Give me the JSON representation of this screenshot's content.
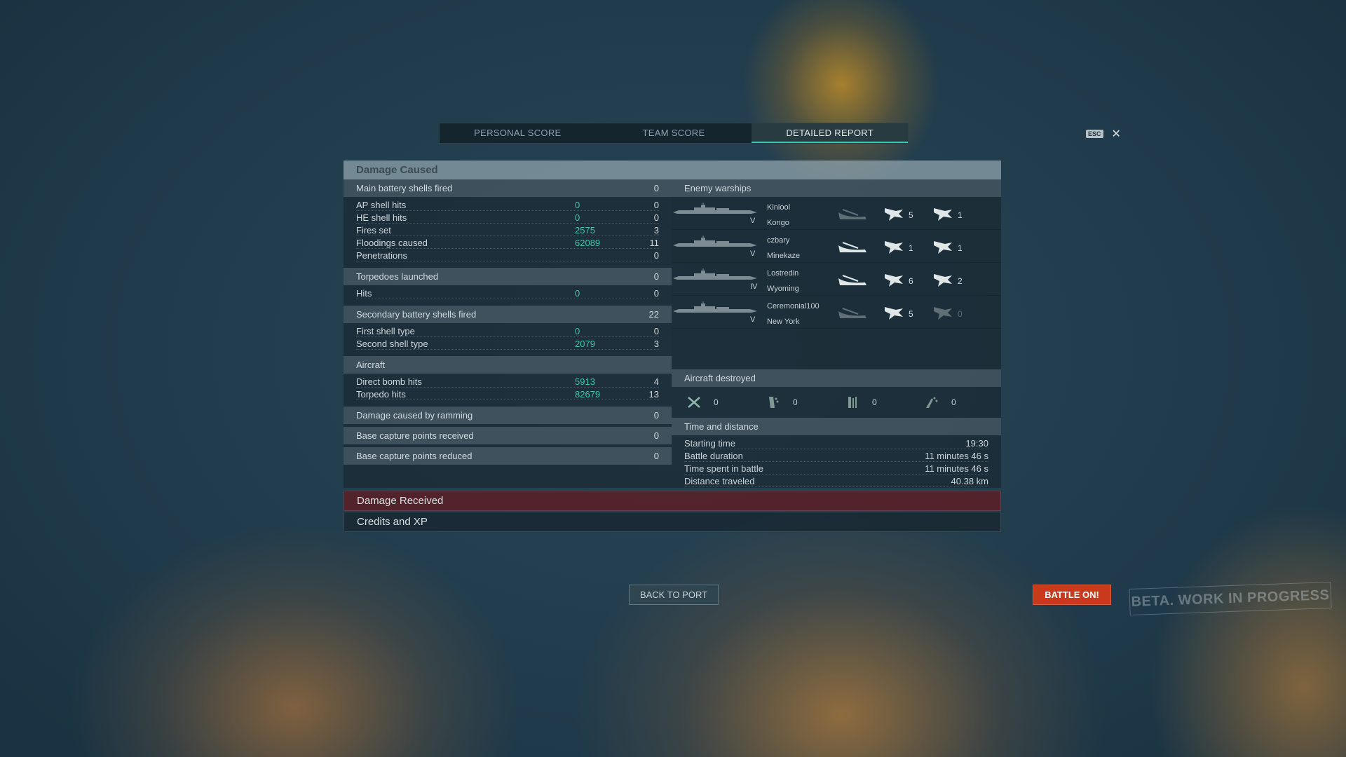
{
  "tabs": [
    "PERSONAL SCORE",
    "TEAM SCORE",
    "DETAILED REPORT"
  ],
  "esc_label": "ESC",
  "close_glyph": "✕",
  "damage_caused": {
    "title": "Damage Caused",
    "main_battery": {
      "label": "Main battery shells fired",
      "value": "0",
      "rows": [
        {
          "label": "AP shell hits",
          "damage": "0",
          "count": "0"
        },
        {
          "label": "HE shell hits",
          "damage": "0",
          "count": "0"
        },
        {
          "label": "Fires set",
          "damage": "2575",
          "count": "3"
        },
        {
          "label": "Floodings caused",
          "damage": "62089",
          "count": "11"
        },
        {
          "label": "Penetrations",
          "damage": "",
          "count": "0"
        }
      ]
    },
    "torpedoes": {
      "label": "Torpedoes launched",
      "value": "0",
      "rows": [
        {
          "label": "Hits",
          "damage": "0",
          "count": "0"
        }
      ]
    },
    "secondary": {
      "label": "Secondary battery shells fired",
      "value": "22",
      "rows": [
        {
          "label": "First shell type",
          "damage": "0",
          "count": "0"
        },
        {
          "label": "Second shell type",
          "damage": "2079",
          "count": "3"
        }
      ]
    },
    "aircraft": {
      "label": "Aircraft",
      "value": "",
      "rows": [
        {
          "label": "Direct bomb hits",
          "damage": "5913",
          "count": "4"
        },
        {
          "label": "Torpedo hits",
          "damage": "82679",
          "count": "13"
        }
      ]
    },
    "ramming": {
      "label": "Damage caused by ramming",
      "value": "0"
    },
    "cap_received": {
      "label": "Base capture points received",
      "value": "0"
    },
    "cap_reduced": {
      "label": "Base capture points reduced",
      "value": "0"
    }
  },
  "enemy_warships": {
    "label": "Enemy warships",
    "ships": [
      {
        "player": "Kiniool",
        "ship": "Kongo",
        "tier": "V",
        "s1": "5",
        "s2": "1",
        "destroyed": false,
        "s2_dim": false
      },
      {
        "player": "czbary",
        "ship": "Minekaze",
        "tier": "V",
        "s1": "1",
        "s2": "1",
        "destroyed": true,
        "s2_dim": false
      },
      {
        "player": "Lostredin",
        "ship": "Wyoming",
        "tier": "IV",
        "s1": "6",
        "s2": "2",
        "destroyed": true,
        "s2_dim": false
      },
      {
        "player": "Ceremonial100",
        "ship": "New York",
        "tier": "V",
        "s1": "5",
        "s2": "0",
        "destroyed": false,
        "s2_dim": true
      }
    ]
  },
  "aircraft_destroyed": {
    "label": "Aircraft destroyed",
    "items": [
      {
        "icon": "fighter-icon",
        "value": "0"
      },
      {
        "icon": "dive-bomber-icon",
        "value": "0"
      },
      {
        "icon": "torpedo-bomber-icon",
        "value": "0"
      },
      {
        "icon": "scout-icon",
        "value": "0"
      }
    ]
  },
  "time_distance": {
    "label": "Time and distance",
    "rows": [
      {
        "label": "Starting time",
        "value": "19:30"
      },
      {
        "label": "Battle duration",
        "value": "11 minutes 46 s"
      },
      {
        "label": "Time spent in battle",
        "value": "11 minutes 46 s"
      },
      {
        "label": "Distance traveled",
        "value": "40.38 km"
      }
    ]
  },
  "damage_received": "Damage Received",
  "credits_xp": "Credits and XP",
  "back_to_port": "BACK TO PORT",
  "battle_on": "BATTLE ON!",
  "beta": "BETA. WORK IN PROGRESS"
}
